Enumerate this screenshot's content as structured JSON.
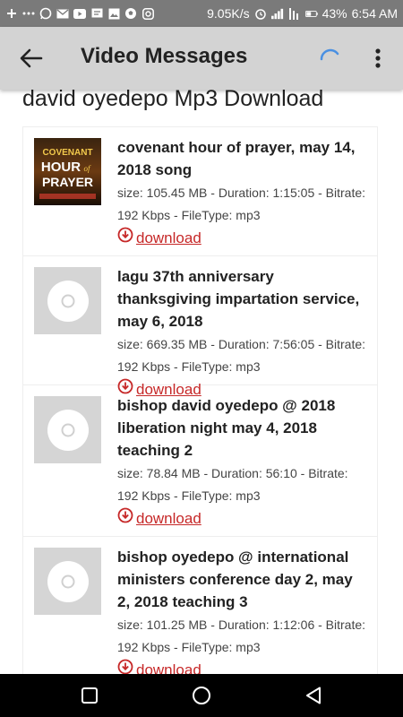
{
  "status_bar": {
    "speed": "9.05K/s",
    "battery": "43%",
    "time": "6:54 AM"
  },
  "app_bar": {
    "title": "Video Messages"
  },
  "page": {
    "heading": "david oyedepo Mp3 Download"
  },
  "items": [
    {
      "title": "covenant hour of prayer, may 14, 2018 song",
      "meta": "size: 105.45 MB - Duration: 1:15:05 - Bitrate: 192 Kbps - FileType: mp3",
      "download_label": "download",
      "thumb_text_1": "COVENANT",
      "thumb_text_2": "HOUR",
      "thumb_text_3": "of",
      "thumb_text_4": "PRAYER"
    },
    {
      "title": "lagu 37th anniversary thanksgiving impartation service, may 6, 2018",
      "meta": "size: 669.35 MB - Duration: 7:56:05 - Bitrate: 192 Kbps - FileType: mp3",
      "download_label": "download"
    },
    {
      "title": "bishop david oyedepo @ 2018 liberation night may 4, 2018 teaching 2",
      "meta": "size: 78.84 MB - Duration: 56:10 - Bitrate: 192 Kbps - FileType: mp3",
      "download_label": "download"
    },
    {
      "title": "bishop oyedepo @ international ministers conference day 2, may 2, 2018 teaching 3",
      "meta": "size: 101.25 MB - Duration: 1:12:06 - Bitrate: 192 Kbps - FileType: mp3",
      "download_label": "download"
    }
  ],
  "colors": {
    "status_bar": "#7a7a7a",
    "app_bar": "#d3d3d3",
    "download_link": "#c62828",
    "spinner": "#4a90e2"
  }
}
